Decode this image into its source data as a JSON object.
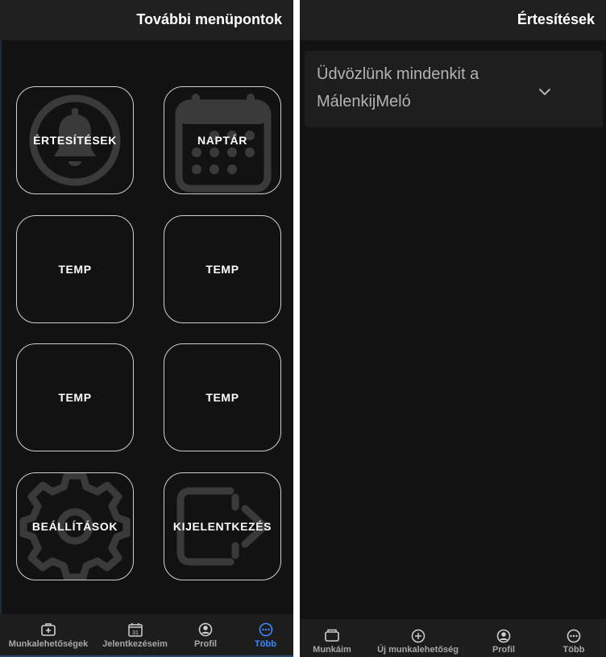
{
  "more_screen": {
    "title": "További menüpontok",
    "tiles": [
      {
        "label": "ÉRTESÍTÉSEK",
        "icon": "bell-icon"
      },
      {
        "label": "NAPTÁR",
        "icon": "calendar-icon"
      },
      {
        "label": "TEMP",
        "icon": ""
      },
      {
        "label": "TEMP",
        "icon": ""
      },
      {
        "label": "TEMP",
        "icon": ""
      },
      {
        "label": "TEMP",
        "icon": ""
      },
      {
        "label": "BEÁLLÍTÁSOK",
        "icon": "gear-icon"
      },
      {
        "label": "KIJELENTKEZÉS",
        "icon": "logout-icon"
      }
    ],
    "nav": [
      {
        "label": "Munkalehetőségek",
        "icon": "briefcase-plus-icon",
        "active": false
      },
      {
        "label": "Jelentkezéseim",
        "icon": "calendar-31-icon",
        "active": false
      },
      {
        "label": "Profil",
        "icon": "user-circle-icon",
        "active": true
      },
      {
        "label": "Több",
        "icon": "more-dots-icon",
        "active": true
      }
    ]
  },
  "notifications_screen": {
    "title": "Értesítések",
    "accordion_text": "Üdvözlünk mindenkit a MálenkijMeló",
    "nav": [
      {
        "label": "Munkáim",
        "icon": "briefcase-icon"
      },
      {
        "label": "Új munkalehetőség",
        "icon": "plus-circle-icon"
      },
      {
        "label": "Profil",
        "icon": "user-circle-icon"
      },
      {
        "label": "Több",
        "icon": "more-dots-icon"
      }
    ]
  },
  "colors": {
    "background": "#121212",
    "header": "#1f1f1f",
    "navbar": "#1d1d1d",
    "active": "#3d8bff",
    "inactive_label": "#a8a8a8"
  }
}
